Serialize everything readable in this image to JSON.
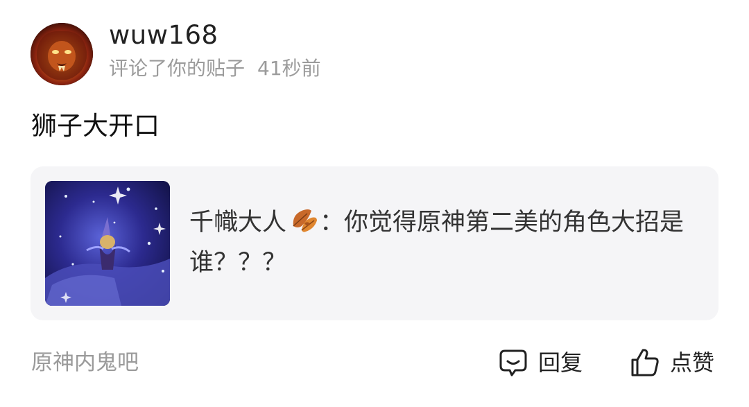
{
  "notification": {
    "username": "wuw168",
    "action_text": "评论了你的贴子",
    "time_ago": "41秒前",
    "avatar_icon": "lion-avatar-icon"
  },
  "comment": {
    "text": "狮子大开口"
  },
  "quoted_post": {
    "author": "千幟大人",
    "author_badge_icon": "autumn-leaf-icon",
    "separator": "：",
    "content": "你觉得原神第二美的角色大招是谁？？？"
  },
  "footer": {
    "forum_name": "原神内鬼吧",
    "reply_label": "回复",
    "like_label": "点赞"
  },
  "colors": {
    "card_background": "#f5f5f7",
    "meta_text": "#9b9b9b",
    "primary_text": "#111111"
  }
}
